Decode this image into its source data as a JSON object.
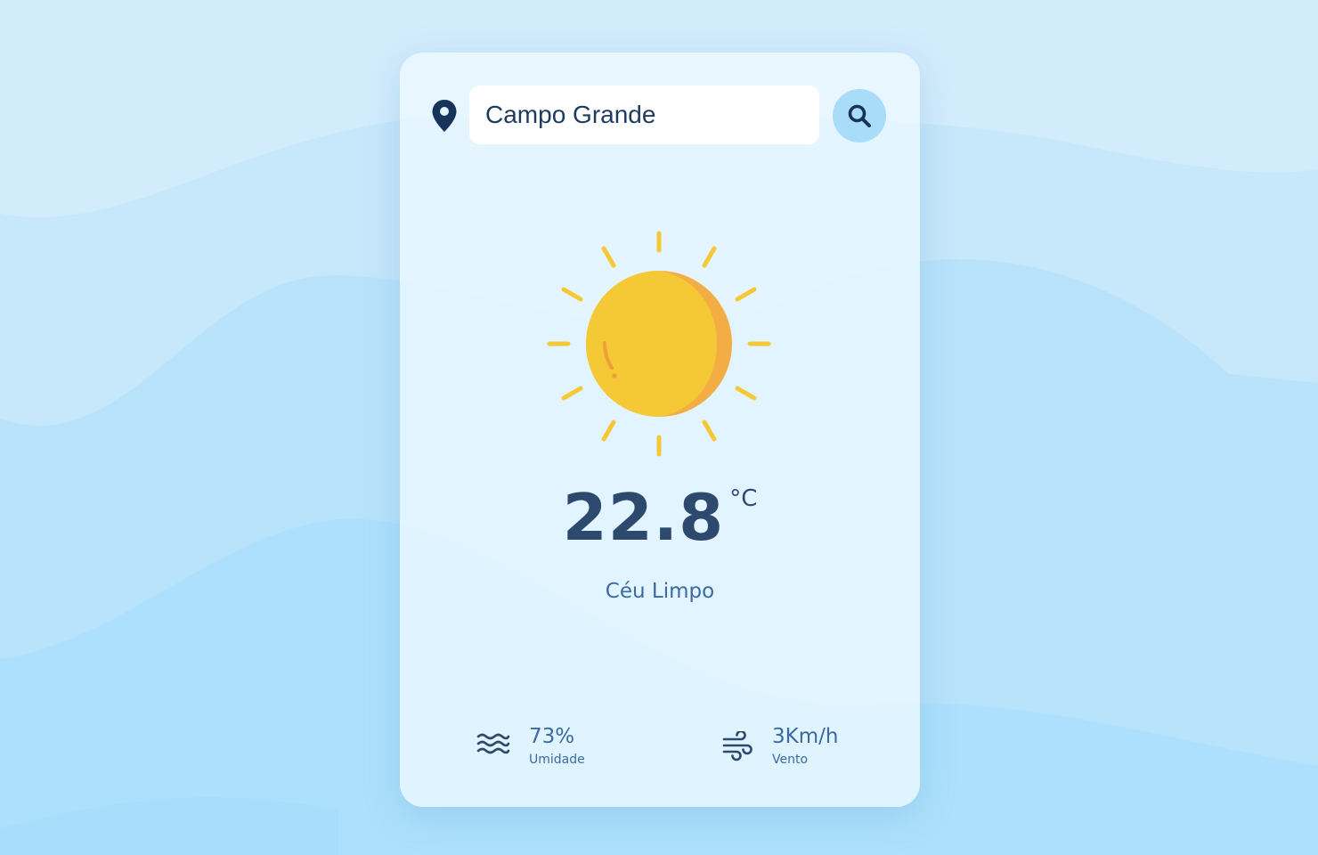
{
  "search": {
    "value": "Campo Grande",
    "placeholder": ""
  },
  "weather": {
    "temperature": "22.8",
    "unit": "°C",
    "condition": "Céu Limpo",
    "icon": "sun-icon"
  },
  "stats": {
    "humidity": {
      "value": "73%",
      "label": "Umidade",
      "icon": "humidity-waves-icon"
    },
    "wind": {
      "value": "3Km/h",
      "label": "Vento",
      "icon": "wind-icon"
    }
  },
  "icons": {
    "location": "location-pin-icon",
    "search": "search-icon"
  },
  "colors": {
    "background": "#d2ecfc",
    "card": "#ecf8ff",
    "accent": "#a9dcf8",
    "text_dark": "#2d4a6e",
    "text": "#3c6aa0",
    "sun": "#f5c836",
    "sun_shade": "#f2ad45"
  }
}
